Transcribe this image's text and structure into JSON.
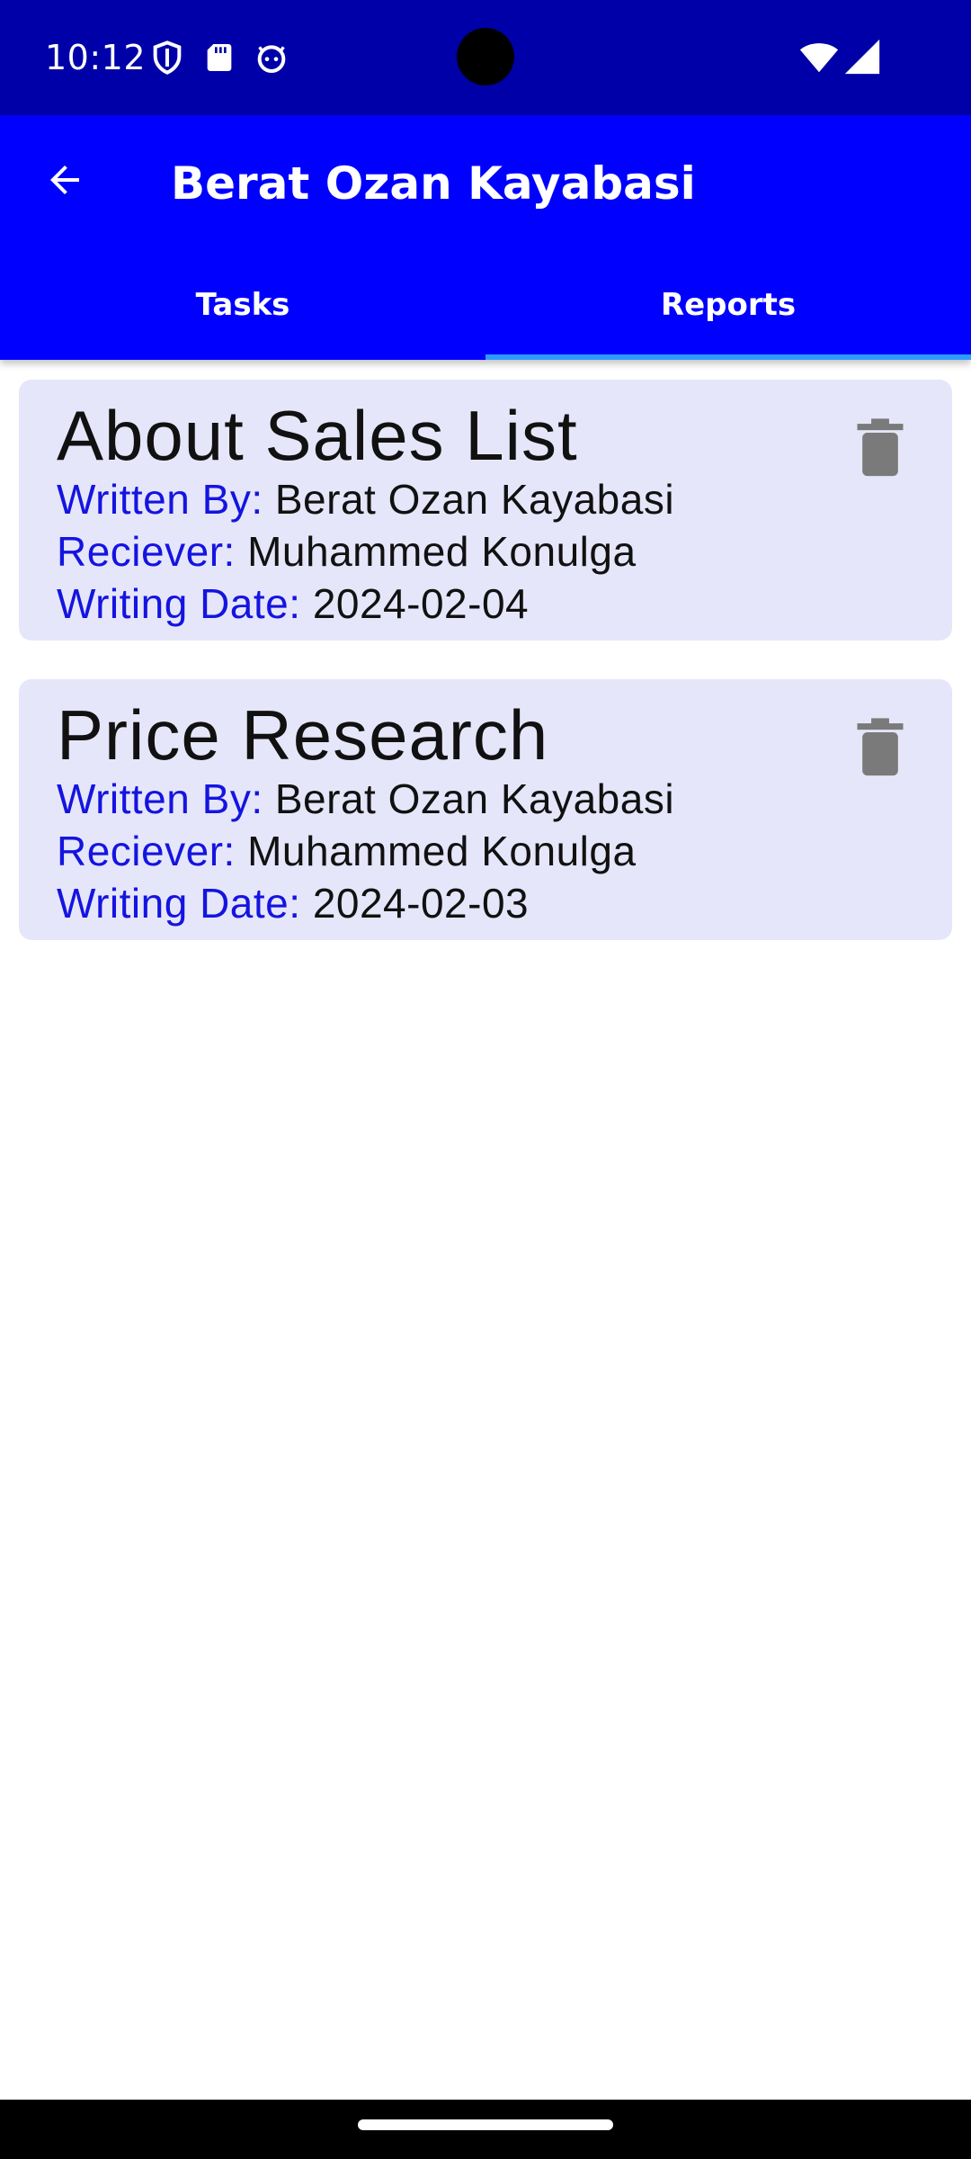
{
  "status_bar": {
    "time": "10:12",
    "icons": [
      "shield-icon",
      "sd-card-icon",
      "android-debug-icon",
      "wifi-icon",
      "cell-signal-icon"
    ]
  },
  "app_bar": {
    "back_icon": "arrow-back-icon",
    "title": "Berat Ozan Kayabasi",
    "tabs": [
      {
        "label": "Tasks",
        "selected": false
      },
      {
        "label": "Reports",
        "selected": true
      }
    ],
    "indicator_color": "#2E9BFF"
  },
  "reports": [
    {
      "title": "About Sales List",
      "written_by_label": "Written By:",
      "written_by": "Berat Ozan Kayabasi",
      "receiver_label": "Reciever:",
      "receiver": "Muhammed Konulga",
      "date_label": "Writing Date:",
      "date": "2024-02-04",
      "action_icon": "delete-icon"
    },
    {
      "title": "Price Research",
      "written_by_label": "Written By:",
      "written_by": "Berat Ozan Kayabasi",
      "receiver_label": "Reciever:",
      "receiver": "Muhammed Konulga",
      "date_label": "Writing Date:",
      "date": "2024-02-03",
      "action_icon": "delete-icon"
    }
  ],
  "colors": {
    "status_bar": "#0000A8",
    "app_bar": "#0000FF",
    "card_background": "#E6E6FA",
    "label_blue": "#1414E0",
    "icon_gray": "#7A7A7A"
  }
}
